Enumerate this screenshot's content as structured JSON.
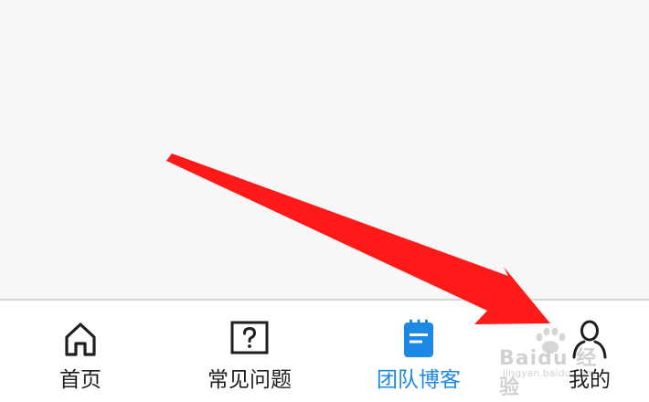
{
  "tabs": [
    {
      "id": "home",
      "label": "首页",
      "icon": "home-icon",
      "active": false
    },
    {
      "id": "faq",
      "label": "常见问题",
      "icon": "question-icon",
      "active": false
    },
    {
      "id": "blog",
      "label": "团队博客",
      "icon": "notepad-icon",
      "active": true
    },
    {
      "id": "mine",
      "label": "我的",
      "icon": "user-icon",
      "active": false
    }
  ],
  "watermark": {
    "brand": "Baidu 经验",
    "url": "jingyan.baidu.com"
  },
  "colors": {
    "background": "#f7f7f7",
    "tab_bar": "#ffffff",
    "active": "#1e88e5",
    "inactive": "#1f1f1f",
    "annotation_arrow": "#ff1a1a"
  }
}
